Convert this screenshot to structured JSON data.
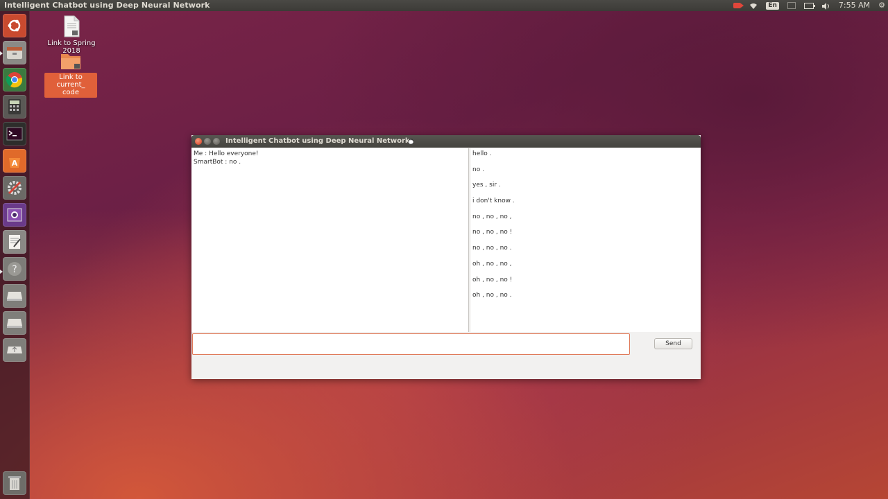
{
  "top_panel": {
    "app_title": "Intelligent Chatbot using Deep Neural Network",
    "language": "En",
    "time": "7:55 AM",
    "indicators": [
      "camera-icon",
      "wifi-icon",
      "keyboard-lang",
      "mail-icon",
      "battery-icon",
      "volume-icon",
      "gear-icon"
    ]
  },
  "launcher": {
    "items": [
      "ubuntu-dash",
      "files",
      "chrome",
      "calculator",
      "terminal",
      "software-center",
      "system-settings",
      "screenshot-tool",
      "text-editor",
      "help",
      "drive",
      "drive",
      "usb-drive",
      "trash"
    ]
  },
  "desktop": {
    "icons": [
      {
        "label": "Link to Spring 2018"
      },
      {
        "label_line1": "Link to current_",
        "label_line2": "code"
      }
    ]
  },
  "window": {
    "title": "Intelligent Chatbot using Deep Neural Network",
    "chat_log": [
      "Me : Hello everyone!",
      "SmartBot : no ."
    ],
    "responses": [
      "hello .",
      "no .",
      "yes , sir .",
      "i don't know .",
      "no , no , no ,",
      "no , no , no !",
      "no , no , no .",
      "oh , no , no ,",
      "oh , no , no !",
      "oh , no , no ."
    ],
    "input": {
      "value": "",
      "placeholder": ""
    },
    "send_label": "Send"
  },
  "colors": {
    "panel_bg": "#3c3b37",
    "accent": "#e0603a",
    "close_button": "#e0553a"
  }
}
